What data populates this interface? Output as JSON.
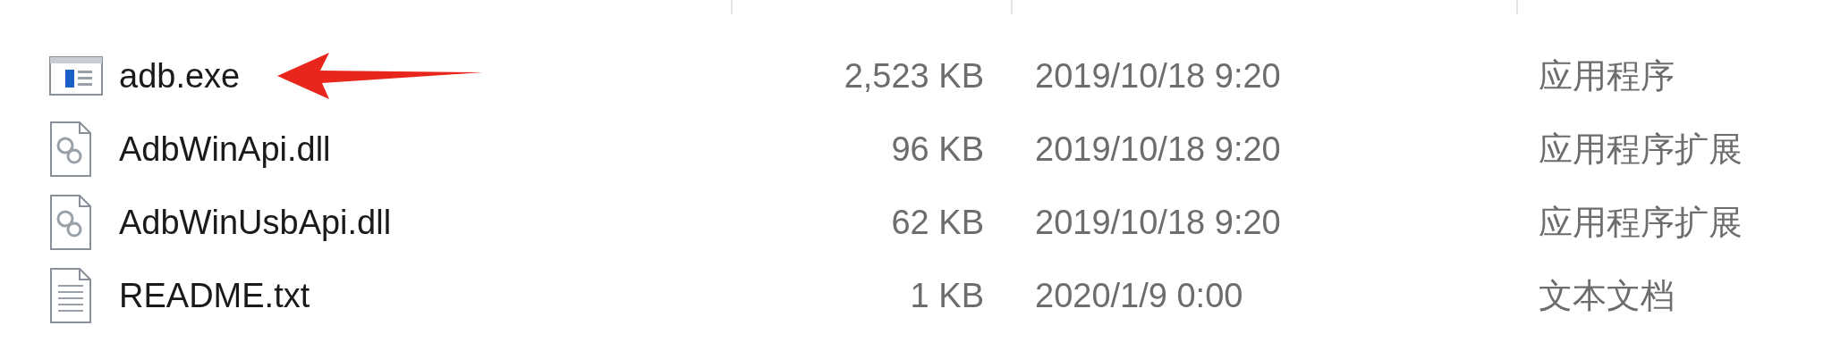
{
  "files": [
    {
      "name": "adb.exe",
      "kind": "exe",
      "size": "2,523 KB",
      "modified": "2019/10/18 9:20",
      "type": "应用程序",
      "pointed": true
    },
    {
      "name": "AdbWinApi.dll",
      "kind": "dll",
      "size": "96 KB",
      "modified": "2019/10/18 9:20",
      "type": "应用程序扩展",
      "pointed": false
    },
    {
      "name": "AdbWinUsbApi.dll",
      "kind": "dll",
      "size": "62 KB",
      "modified": "2019/10/18 9:20",
      "type": "应用程序扩展",
      "pointed": false
    },
    {
      "name": "README.txt",
      "kind": "txt",
      "size": "1 KB",
      "modified": "2020/1/9 0:00",
      "type": "文本文档",
      "pointed": false
    }
  ]
}
